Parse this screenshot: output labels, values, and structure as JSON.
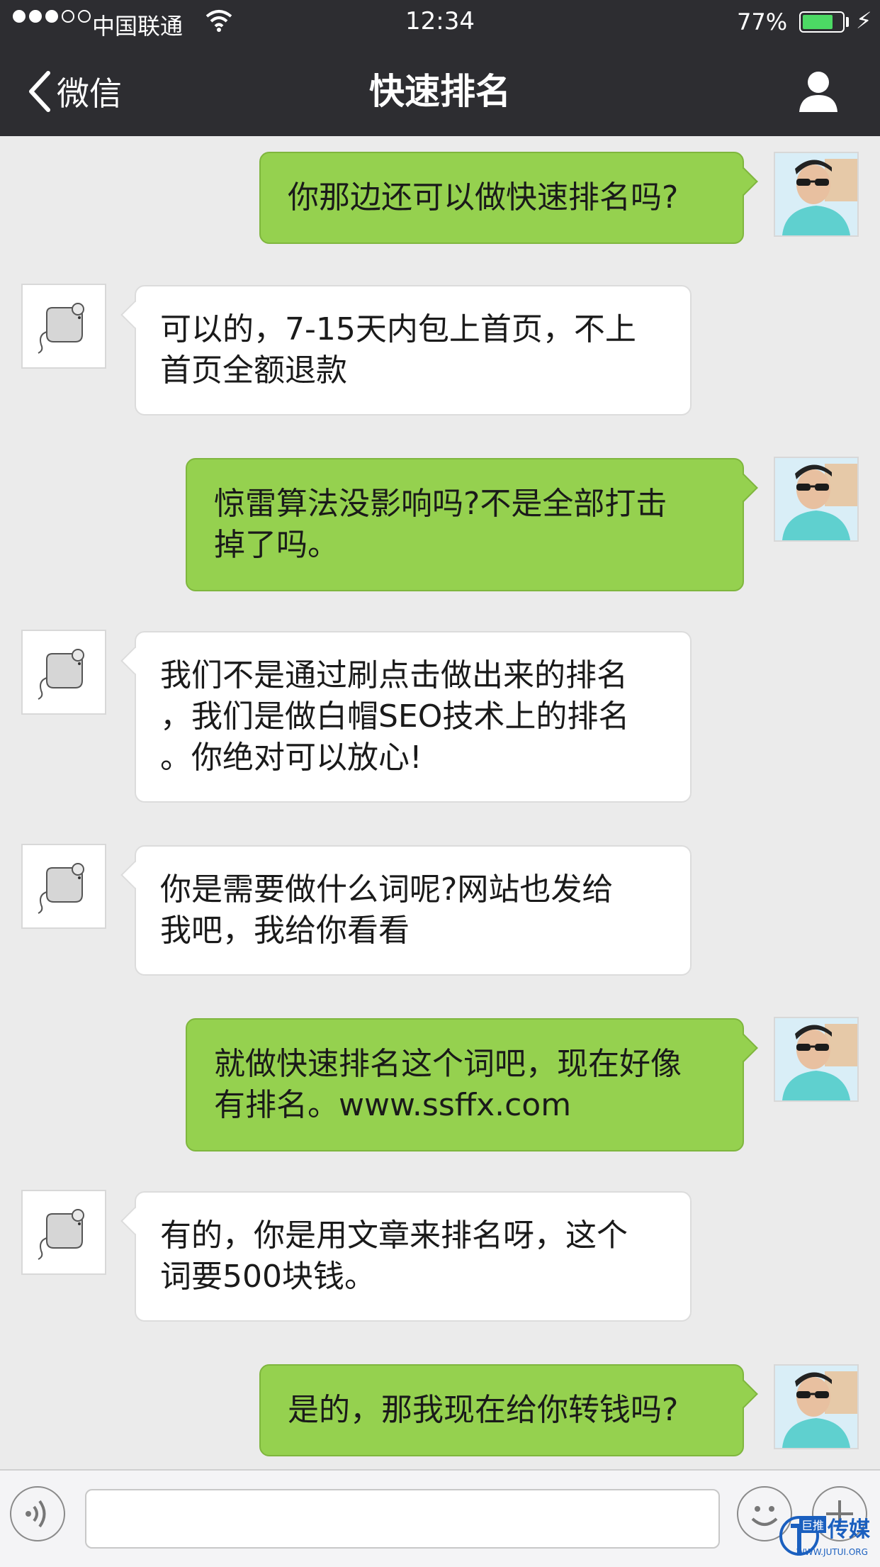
{
  "status_bar": {
    "carrier": "中国联通",
    "time": "12:34",
    "battery_percent": "77%",
    "battery_level": 0.77,
    "signal_bars_filled": 3,
    "signal_bars_total": 5,
    "icons": [
      "wifi-icon",
      "battery-icon",
      "charging-icon"
    ]
  },
  "nav": {
    "back_label": "微信",
    "title": "快速排名",
    "right_icon": "profile-icon"
  },
  "messages": [
    {
      "side": "right",
      "sender": "me",
      "lines": [
        "你那边还可以做快速排名吗?"
      ]
    },
    {
      "side": "left",
      "sender": "contact",
      "lines": [
        "可以的，7-15天内包上首页，不上",
        "首页全额退款"
      ]
    },
    {
      "side": "right",
      "sender": "me",
      "lines": [
        "惊雷算法没影响吗?不是全部打击",
        "掉了吗。"
      ]
    },
    {
      "side": "left",
      "sender": "contact",
      "lines": [
        "我们不是通过刷点击做出来的排名",
        "，我们是做白帽SEO技术上的排名",
        "。你绝对可以放心!"
      ]
    },
    {
      "side": "left",
      "sender": "contact",
      "lines": [
        "你是需要做什么词呢?网站也发给",
        "我吧，我给你看看"
      ]
    },
    {
      "side": "right",
      "sender": "me",
      "lines": [
        "就做快速排名这个词吧，现在好像",
        "有排名。www.ssffx.com"
      ]
    },
    {
      "side": "left",
      "sender": "contact",
      "lines": [
        "有的，你是用文章来排名呀，这个",
        "词要500块钱。"
      ]
    },
    {
      "side": "right",
      "sender": "me",
      "lines": [
        "是的，那我现在给你转钱吗?"
      ]
    }
  ],
  "input_bar": {
    "text_value": "",
    "icons": [
      "voice-icon",
      "emoji-icon",
      "plus-icon"
    ]
  },
  "watermark": {
    "tag": "巨推",
    "name": "传媒",
    "url": "WWW.JUTUI.ORG"
  },
  "colors": {
    "nav_bg": "#2d2d31",
    "chat_bg": "#ebebeb",
    "my_bubble": "#95d14f",
    "their_bubble": "#ffffff",
    "battery": "#4cd964"
  }
}
